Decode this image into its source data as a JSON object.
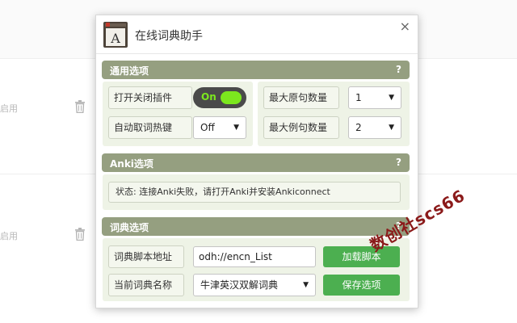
{
  "background": {
    "rows": [
      {
        "status": "启用"
      },
      {
        "status": "启用"
      }
    ]
  },
  "popup": {
    "title": "在线词典助手",
    "logo_letter": "A",
    "close_symbol": "×"
  },
  "general": {
    "header": "通用选项",
    "help": "?",
    "toggle_label": "打开关闭插件",
    "toggle_state": "On",
    "hotkey_label": "自动取词热键",
    "hotkey_value": "Off",
    "max_sentence_label": "最大原句数量",
    "max_sentence_value": "1",
    "max_example_label": "最大例句数量",
    "max_example_value": "2"
  },
  "anki": {
    "header": "Anki选项",
    "help": "?",
    "status": "状态: 连接Anki失败，请打开Anki并安装Ankiconnect"
  },
  "dictionary": {
    "header": "词典选项",
    "help": "?",
    "script_label": "词典脚本地址",
    "script_value": "odh://encn_List",
    "load_button": "加载脚本",
    "current_label": "当前词典名称",
    "current_value": "牛津英汉双解词典",
    "save_button": "保存选项"
  },
  "watermark": "数创社scs66",
  "colors": {
    "section_header": "#959f80",
    "panel": "#eef3e6",
    "green_button": "#4caf50",
    "toggle_on": "#7ce81e"
  }
}
